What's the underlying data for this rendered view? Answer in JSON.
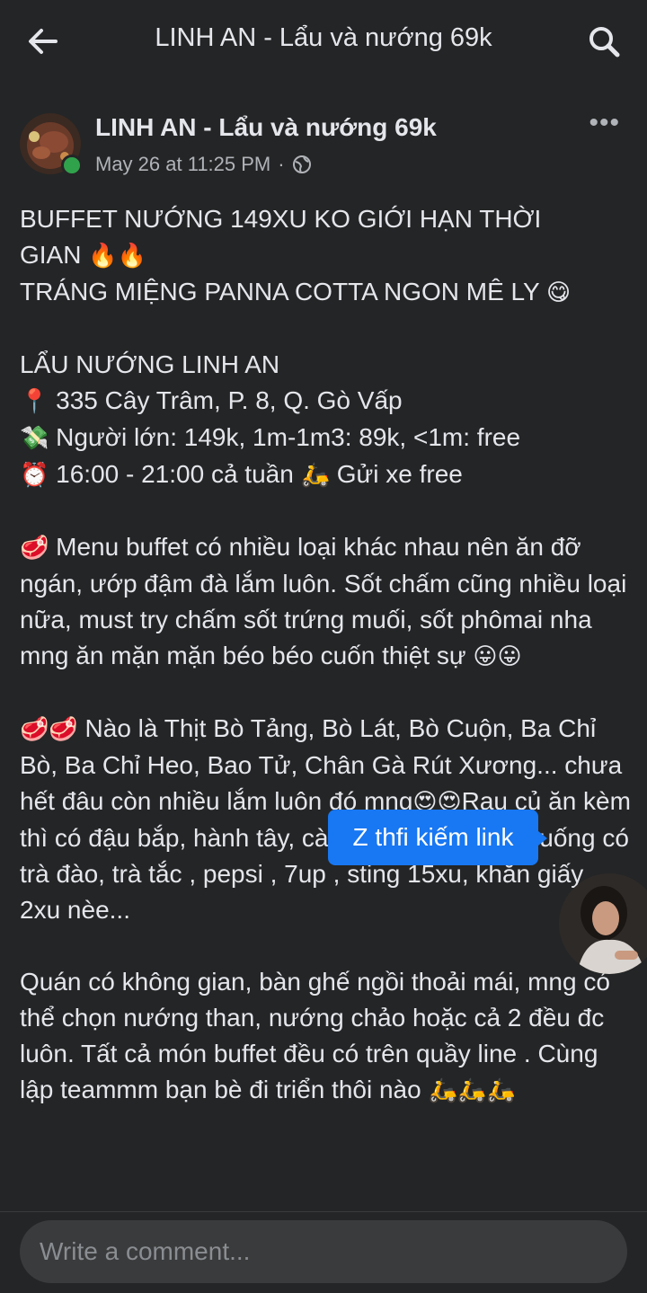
{
  "header": {
    "title": "LINH AN - Lẩu và nướng 69k",
    "back_icon": "arrow-left-icon",
    "search_icon": "search-icon"
  },
  "post": {
    "page_name": "LINH AN - Lẩu và nướng 69k",
    "timestamp": "May 26 at 11:25 PM",
    "separator": "·",
    "privacy_icon": "globe-icon",
    "more_label": "•••",
    "lines": {
      "l1": "BUFFET NƯỚNG 149XU KO GIỚI HẠN THỜI",
      "l2": "GIAN",
      "l2_emoji": "🔥🔥",
      "l3": "TRÁNG MIỆNG PANNA COTTA NGON MÊ LY",
      "l3_emoji": "😋",
      "l4": "LẨU NƯỚNG LINH AN",
      "l5_emoji": "📍",
      "l5": "335 Cây Trâm, P. 8, Q. Gò Vấp",
      "l6_emoji": "💸",
      "l6": "Người lớn: 149k, 1m-1m3: 89k, <1m: free",
      "l7_emoji": "⏰",
      "l7": "16:00 - 21:00 cả tuần",
      "l7_emoji2": "🛵",
      "l7b": "Gửi xe free",
      "p1_emoji": "🥩",
      "p1": "Menu buffet có nhiều loại khác nhau nên ăn đỡ ngán, ướp đậm đà lắm luôn. Sốt chấm cũng nhiều loại nữa, must try chấm sốt trứng muối, sốt phômai nha mng ăn mặn mặn béo béo cuốn thiệt sự",
      "p1_end_emoji": "😛😛",
      "p2_emoji": "🥩🥩",
      "p2a": "Nào là Thịt Bò Tảng, Bò Lát, Bò Cuộn, Ba Chỉ Bò, Ba Chỉ Heo, Bao Tử, Chân Gà Rút Xương... chưa hết đâu còn nhiều lắm luôn đó mng",
      "p2_mid_emoji": "😍😍",
      "p2b": "Rau củ ăn kèm thì có đậu bắp, hành tây, cà tím đồ nha. Nước uống có trà đào, trà tắc , pepsi , 7up , sting 15xu, khăn giấy 2xu nèe...",
      "p3": "Quán có không gian, bàn ghế ngồi thoải mái, mng có thể chọn nướng than, nướng chảo hoặc cả 2 đều đc luôn. Tất cả món buffet đều có trên quầy line . Cùng lập teammm bạn bè đi triển thôi nào",
      "p3_emoji": "🛵🛵🛵"
    }
  },
  "overlay": {
    "tooltip": "Z thfi kiếm link"
  },
  "comment": {
    "placeholder": "Write a comment..."
  },
  "colors": {
    "background": "#18191a",
    "surface": "#242526",
    "text": "#e4e6eb",
    "secondary_text": "#b0b3b8",
    "accent": "#1877f2",
    "online": "#31a24c"
  }
}
